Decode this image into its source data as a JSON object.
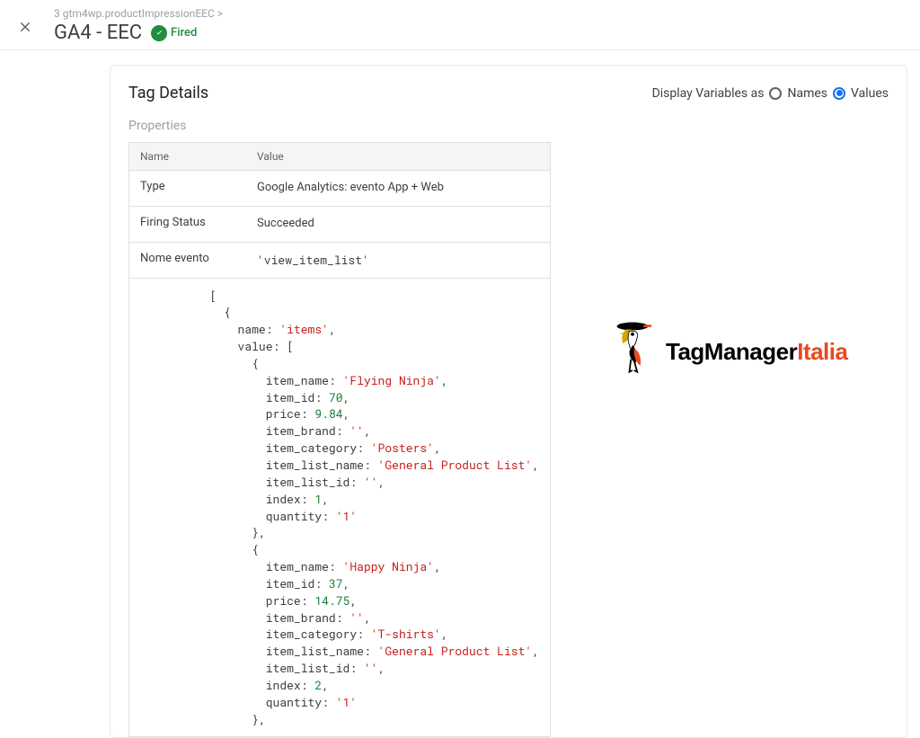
{
  "header": {
    "breadcrumb": "3 gtm4wp.productImpressionEEC >",
    "title": "GA4 - EEC",
    "fired_label": "Fired"
  },
  "card": {
    "title": "Tag Details",
    "display_vars_label": "Display Variables as",
    "radio_names": "Names",
    "radio_values": "Values",
    "section_label": "Properties",
    "col_name": "Name",
    "col_value": "Value",
    "rows": {
      "type_label": "Type",
      "type_value": "Google Analytics: evento App + Web",
      "firing_label": "Firing Status",
      "firing_value": "Succeeded",
      "event_label": "Nome evento"
    }
  },
  "event_name": "'view_item_list'",
  "code_block": "[\n  {\n    name: 'items',\n    value: [\n      {\n        item_name: 'Flying Ninja',\n        item_id: 70,\n        price: 9.84,\n        item_brand: '',\n        item_category: 'Posters',\n        item_list_name: 'General Product List',\n        item_list_id: '',\n        index: 1,\n        quantity: '1'\n      },\n      {\n        item_name: 'Happy Ninja',\n        item_id: 37,\n        price: 14.75,\n        item_brand: '',\n        item_category: 'T-shirts',\n        item_list_name: 'General Product List',\n        item_list_id: '',\n        index: 2,\n        quantity: '1'\n      },",
  "logo": {
    "text_a": "TagManager",
    "text_b": "Italia"
  },
  "chart_data": {
    "type": "table",
    "event": "view_item_list",
    "items": [
      {
        "item_name": "Flying Ninja",
        "item_id": 70,
        "price": 9.84,
        "item_brand": "",
        "item_category": "Posters",
        "item_list_name": "General Product List",
        "item_list_id": "",
        "index": 1,
        "quantity": "1"
      },
      {
        "item_name": "Happy Ninja",
        "item_id": 37,
        "price": 14.75,
        "item_brand": "",
        "item_category": "T-shirts",
        "item_list_name": "General Product List",
        "item_list_id": "",
        "index": 2,
        "quantity": "1"
      }
    ]
  }
}
